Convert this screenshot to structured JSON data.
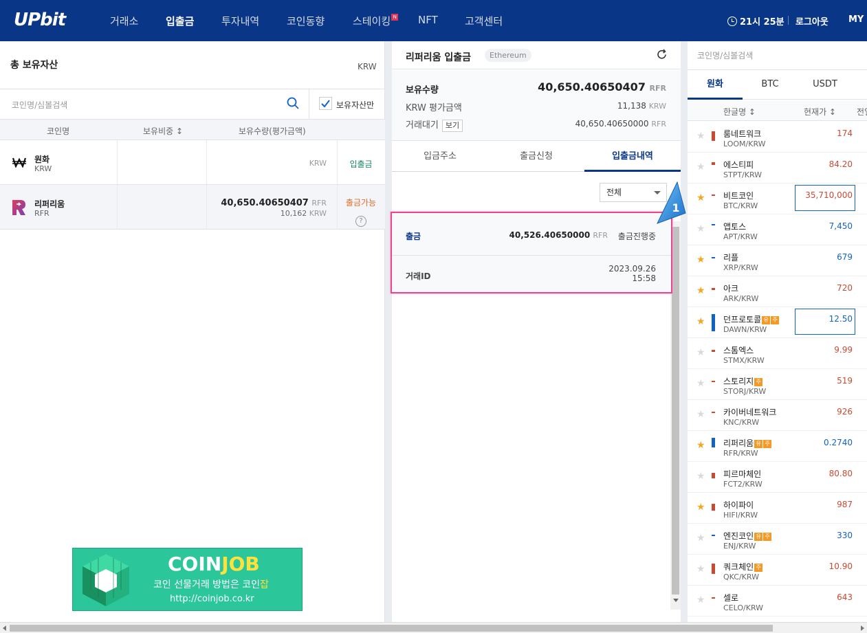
{
  "header": {
    "logo": "UPbit",
    "nav": [
      "거래소",
      "입출금",
      "투자내역",
      "코인동향",
      "스테이킹",
      "NFT",
      "고객센터"
    ],
    "nav_active": "입출금",
    "staking_badge": "N",
    "time": "21시 25분",
    "logout": "로그아웃",
    "my": "MY"
  },
  "assets": {
    "title": "총 보유자산",
    "currency": "KRW",
    "search_placeholder": "코인명/심볼검색",
    "owned_only_label": "보유자산만",
    "owned_only_checked": true,
    "columns": [
      "코인명",
      "보유비중 ↕",
      "보유수량(평가금액)"
    ],
    "rows": [
      {
        "name": "원화",
        "symbol": "KRW",
        "amount": "",
        "amount_unit": "KRW",
        "value": "",
        "action": "입출금"
      },
      {
        "name": "리퍼리움",
        "symbol": "RFR",
        "amount": "40,650.40650407",
        "amount_unit": "RFR",
        "value": "10,162",
        "value_unit": "KRW",
        "action": "출금가능",
        "help": "?"
      }
    ]
  },
  "detail": {
    "title": "리퍼리움 입출금",
    "network": "Ethereum",
    "holding_label": "보유수량",
    "holding_value": "40,650.40650407",
    "holding_unit": "RFR",
    "krw_label": "KRW 평가금액",
    "krw_value": "11,138",
    "krw_unit": "KRW",
    "pending_label": "거래대기",
    "view_button": "보기",
    "pending_value": "40,650.40650000",
    "pending_unit": "RFR",
    "tabs": [
      "입금주소",
      "출금신청",
      "입출금내역"
    ],
    "active_tab": "입출금내역",
    "filter": "전체",
    "history": {
      "type": "출금",
      "amount": "40,526.40650000",
      "unit": "RFR",
      "status": "출금진행중",
      "id_label": "거래ID",
      "date": "2023.09.26",
      "time": "15:58"
    },
    "callout_number": "1"
  },
  "market": {
    "search_placeholder": "코인명/심볼검색",
    "tabs": [
      "원화",
      "BTC",
      "USDT"
    ],
    "active_tab": "원화",
    "columns": [
      "한글명 ↕",
      "현재가 ↕",
      "전일"
    ],
    "coins": [
      {
        "name": "룸네트워크",
        "symbol": "LOOM/KRW",
        "price": "174",
        "dir": "up",
        "fav": false,
        "badges": []
      },
      {
        "name": "에스티피",
        "symbol": "STPT/KRW",
        "price": "84.20",
        "dir": "up",
        "fav": false,
        "badges": []
      },
      {
        "name": "비트코인",
        "symbol": "BTC/KRW",
        "price": "35,710,000",
        "dir": "up",
        "fav": true,
        "badges": [],
        "boxed": true
      },
      {
        "name": "앱토스",
        "symbol": "APT/KRW",
        "price": "7,450",
        "dir": "down",
        "fav": false,
        "badges": []
      },
      {
        "name": "리플",
        "symbol": "XRP/KRW",
        "price": "679",
        "dir": "down",
        "fav": true,
        "badges": []
      },
      {
        "name": "아크",
        "symbol": "ARK/KRW",
        "price": "720",
        "dir": "up",
        "fav": true,
        "badges": []
      },
      {
        "name": "던프로토콜",
        "symbol": "DAWN/KRW",
        "price": "12.50",
        "dir": "down",
        "fav": true,
        "badges": [
          "유",
          "주"
        ],
        "boxed": true
      },
      {
        "name": "스톰엑스",
        "symbol": "STMX/KRW",
        "price": "9.99",
        "dir": "up",
        "fav": false,
        "badges": []
      },
      {
        "name": "스토리지",
        "symbol": "STORJ/KRW",
        "price": "519",
        "dir": "up",
        "fav": false,
        "badges": [
          "주"
        ]
      },
      {
        "name": "카이버네트워크",
        "symbol": "KNC/KRW",
        "price": "926",
        "dir": "up",
        "fav": false,
        "badges": []
      },
      {
        "name": "리퍼리움",
        "symbol": "RFR/KRW",
        "price": "0.2740",
        "dir": "down",
        "fav": true,
        "badges": [
          "유",
          "주"
        ]
      },
      {
        "name": "피르마체인",
        "symbol": "FCT2/KRW",
        "price": "80.80",
        "dir": "up",
        "fav": false,
        "badges": []
      },
      {
        "name": "하이파이",
        "symbol": "HIFI/KRW",
        "price": "987",
        "dir": "up",
        "fav": true,
        "badges": []
      },
      {
        "name": "엔진코인",
        "symbol": "ENJ/KRW",
        "price": "330",
        "dir": "down",
        "fav": false,
        "badges": [
          "유",
          "주"
        ]
      },
      {
        "name": "쿼크체인",
        "symbol": "QKC/KRW",
        "price": "10.90",
        "dir": "up",
        "fav": false,
        "badges": [
          "주"
        ]
      },
      {
        "name": "셀로",
        "symbol": "CELO/KRW",
        "price": "643",
        "dir": "up",
        "fav": false,
        "badges": []
      }
    ]
  },
  "banner": {
    "title_a": "COIN",
    "title_b": "JOB",
    "subtitle_a": "코인 선물거래 방법은 코인",
    "subtitle_b": "잡",
    "url": "http://coinjob.co.kr"
  },
  "colors": {
    "brand": "#093687",
    "rise": "#c84a31",
    "fall": "#1261c4",
    "highlight": "#e8478e",
    "banner": "#2bc79a"
  }
}
